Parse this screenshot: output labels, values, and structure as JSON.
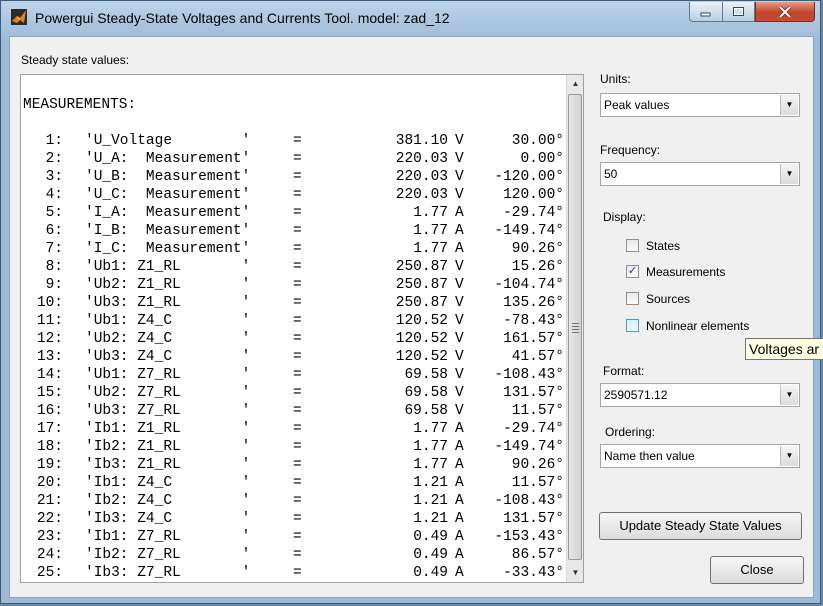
{
  "window": {
    "title": "Powergui Steady-State Voltages and Currents Tool.  model: zad_12"
  },
  "icons": {
    "app": "matlab-icon",
    "minimize": "minimize-icon",
    "maximize": "maximize-icon",
    "close": "close-icon"
  },
  "steady": {
    "label": "Steady state values:",
    "heading": "MEASUREMENTS:",
    "rows": [
      {
        "idx": "1:",
        "name": "'U_Voltage        '",
        "eq": "=",
        "mag": "381.10",
        "unit": "V",
        "ang": "30.00°"
      },
      {
        "idx": "2:",
        "name": "'U_A:  Measurement'",
        "eq": "=",
        "mag": "220.03",
        "unit": "V",
        "ang": "0.00°"
      },
      {
        "idx": "3:",
        "name": "'U_B:  Measurement'",
        "eq": "=",
        "mag": "220.03",
        "unit": "V",
        "ang": "-120.00°"
      },
      {
        "idx": "4:",
        "name": "'U_C:  Measurement'",
        "eq": "=",
        "mag": "220.03",
        "unit": "V",
        "ang": "120.00°"
      },
      {
        "idx": "5:",
        "name": "'I_A:  Measurement'",
        "eq": "=",
        "mag": "1.77",
        "unit": "A",
        "ang": "-29.74°"
      },
      {
        "idx": "6:",
        "name": "'I_B:  Measurement'",
        "eq": "=",
        "mag": "1.77",
        "unit": "A",
        "ang": "-149.74°"
      },
      {
        "idx": "7:",
        "name": "'I_C:  Measurement'",
        "eq": "=",
        "mag": "1.77",
        "unit": "A",
        "ang": "90.26°"
      },
      {
        "idx": "8:",
        "name": "'Ub1: Z1_RL       '",
        "eq": "=",
        "mag": "250.87",
        "unit": "V",
        "ang": "15.26°"
      },
      {
        "idx": "9:",
        "name": "'Ub2: Z1_RL       '",
        "eq": "=",
        "mag": "250.87",
        "unit": "V",
        "ang": "-104.74°"
      },
      {
        "idx": "10:",
        "name": "'Ub3: Z1_RL       '",
        "eq": "=",
        "mag": "250.87",
        "unit": "V",
        "ang": "135.26°"
      },
      {
        "idx": "11:",
        "name": "'Ub1: Z4_C        '",
        "eq": "=",
        "mag": "120.52",
        "unit": "V",
        "ang": "-78.43°"
      },
      {
        "idx": "12:",
        "name": "'Ub2: Z4_C        '",
        "eq": "=",
        "mag": "120.52",
        "unit": "V",
        "ang": "161.57°"
      },
      {
        "idx": "13:",
        "name": "'Ub3: Z4_C        '",
        "eq": "=",
        "mag": "120.52",
        "unit": "V",
        "ang": "41.57°"
      },
      {
        "idx": "14:",
        "name": "'Ub1: Z7_RL       '",
        "eq": "=",
        "mag": "69.58",
        "unit": "V",
        "ang": "-108.43°"
      },
      {
        "idx": "15:",
        "name": "'Ub2: Z7_RL       '",
        "eq": "=",
        "mag": "69.58",
        "unit": "V",
        "ang": "131.57°"
      },
      {
        "idx": "16:",
        "name": "'Ub3: Z7_RL       '",
        "eq": "=",
        "mag": "69.58",
        "unit": "V",
        "ang": "11.57°"
      },
      {
        "idx": "17:",
        "name": "'Ib1: Z1_RL       '",
        "eq": "=",
        "mag": "1.77",
        "unit": "A",
        "ang": "-29.74°"
      },
      {
        "idx": "18:",
        "name": "'Ib2: Z1_RL       '",
        "eq": "=",
        "mag": "1.77",
        "unit": "A",
        "ang": "-149.74°"
      },
      {
        "idx": "19:",
        "name": "'Ib3: Z1_RL       '",
        "eq": "=",
        "mag": "1.77",
        "unit": "A",
        "ang": "90.26°"
      },
      {
        "idx": "20:",
        "name": "'Ib1: Z4_C        '",
        "eq": "=",
        "mag": "1.21",
        "unit": "A",
        "ang": "11.57°"
      },
      {
        "idx": "21:",
        "name": "'Ib2: Z4_C        '",
        "eq": "=",
        "mag": "1.21",
        "unit": "A",
        "ang": "-108.43°"
      },
      {
        "idx": "22:",
        "name": "'Ib3: Z4_C        '",
        "eq": "=",
        "mag": "1.21",
        "unit": "A",
        "ang": "131.57°"
      },
      {
        "idx": "23:",
        "name": "'Ib1: Z7_RL       '",
        "eq": "=",
        "mag": "0.49",
        "unit": "A",
        "ang": "-153.43°"
      },
      {
        "idx": "24:",
        "name": "'Ib2: Z7_RL       '",
        "eq": "=",
        "mag": "0.49",
        "unit": "A",
        "ang": "86.57°"
      },
      {
        "idx": "25:",
        "name": "'Ib3: Z7_RL       '",
        "eq": "=",
        "mag": "0.49",
        "unit": "A",
        "ang": "-33.43°"
      }
    ]
  },
  "units": {
    "label": "Units:",
    "value": "Peak values"
  },
  "frequency": {
    "label": "Frequency:",
    "value": "50"
  },
  "display": {
    "label": "Display:",
    "items": [
      {
        "label": "States",
        "checked": false
      },
      {
        "label": "Measurements",
        "checked": true
      },
      {
        "label": "Sources",
        "checked": false
      },
      {
        "label": "Nonlinear elements",
        "checked": false
      }
    ]
  },
  "format": {
    "label": "Format:",
    "value": "2590571.12"
  },
  "ordering": {
    "label": "Ordering:",
    "value": "Name then value"
  },
  "buttons": {
    "update": "Update Steady State Values",
    "close": "Close"
  },
  "tooltip": "Voltages ar",
  "colors": {
    "title_bar": "#bcd3ea",
    "close_button": "#c2452a",
    "dialog_bg": "#f0f0f0",
    "check_color": "#1d3c7a"
  }
}
